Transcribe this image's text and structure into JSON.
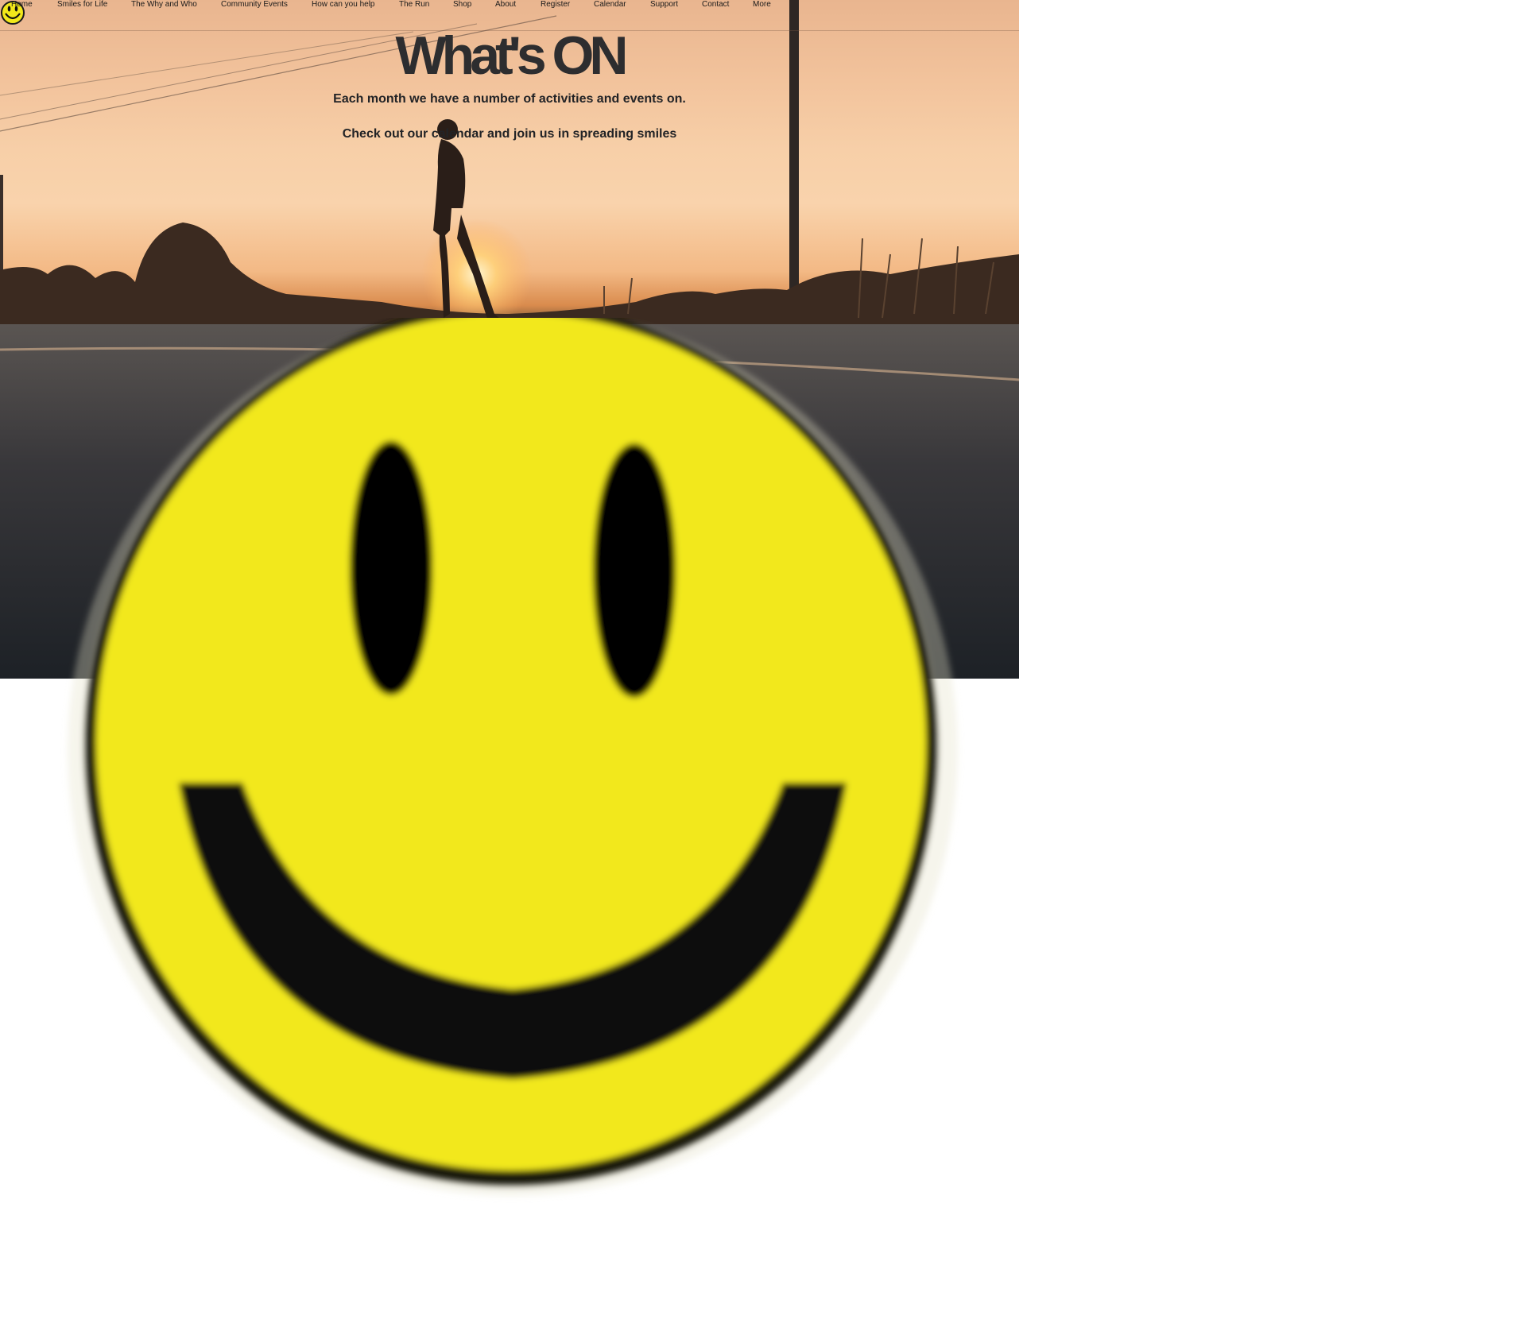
{
  "nav": {
    "items": [
      {
        "label": "Home"
      },
      {
        "label": "Smiles for Life"
      },
      {
        "label": "The Why and Who"
      },
      {
        "label": "Community Events"
      },
      {
        "label": "How can you help"
      },
      {
        "label": "The Run"
      },
      {
        "label": "Shop"
      },
      {
        "label": "About"
      },
      {
        "label": "Register"
      },
      {
        "label": "Calendar"
      },
      {
        "label": "Support"
      },
      {
        "label": "Contact"
      },
      {
        "label": "More"
      }
    ]
  },
  "hero": {
    "title": "What's ON",
    "line1": "Each month we have a number of activities and events on.",
    "line2": "Check out our calendar and join us in spreading smiles"
  },
  "colors": {
    "smiley_yellow": "#f2e81a",
    "text_dark": "#222326"
  },
  "icons": {
    "logo": "smiley-face-icon",
    "hero_image": "person-walking-road-sunset-photo"
  }
}
